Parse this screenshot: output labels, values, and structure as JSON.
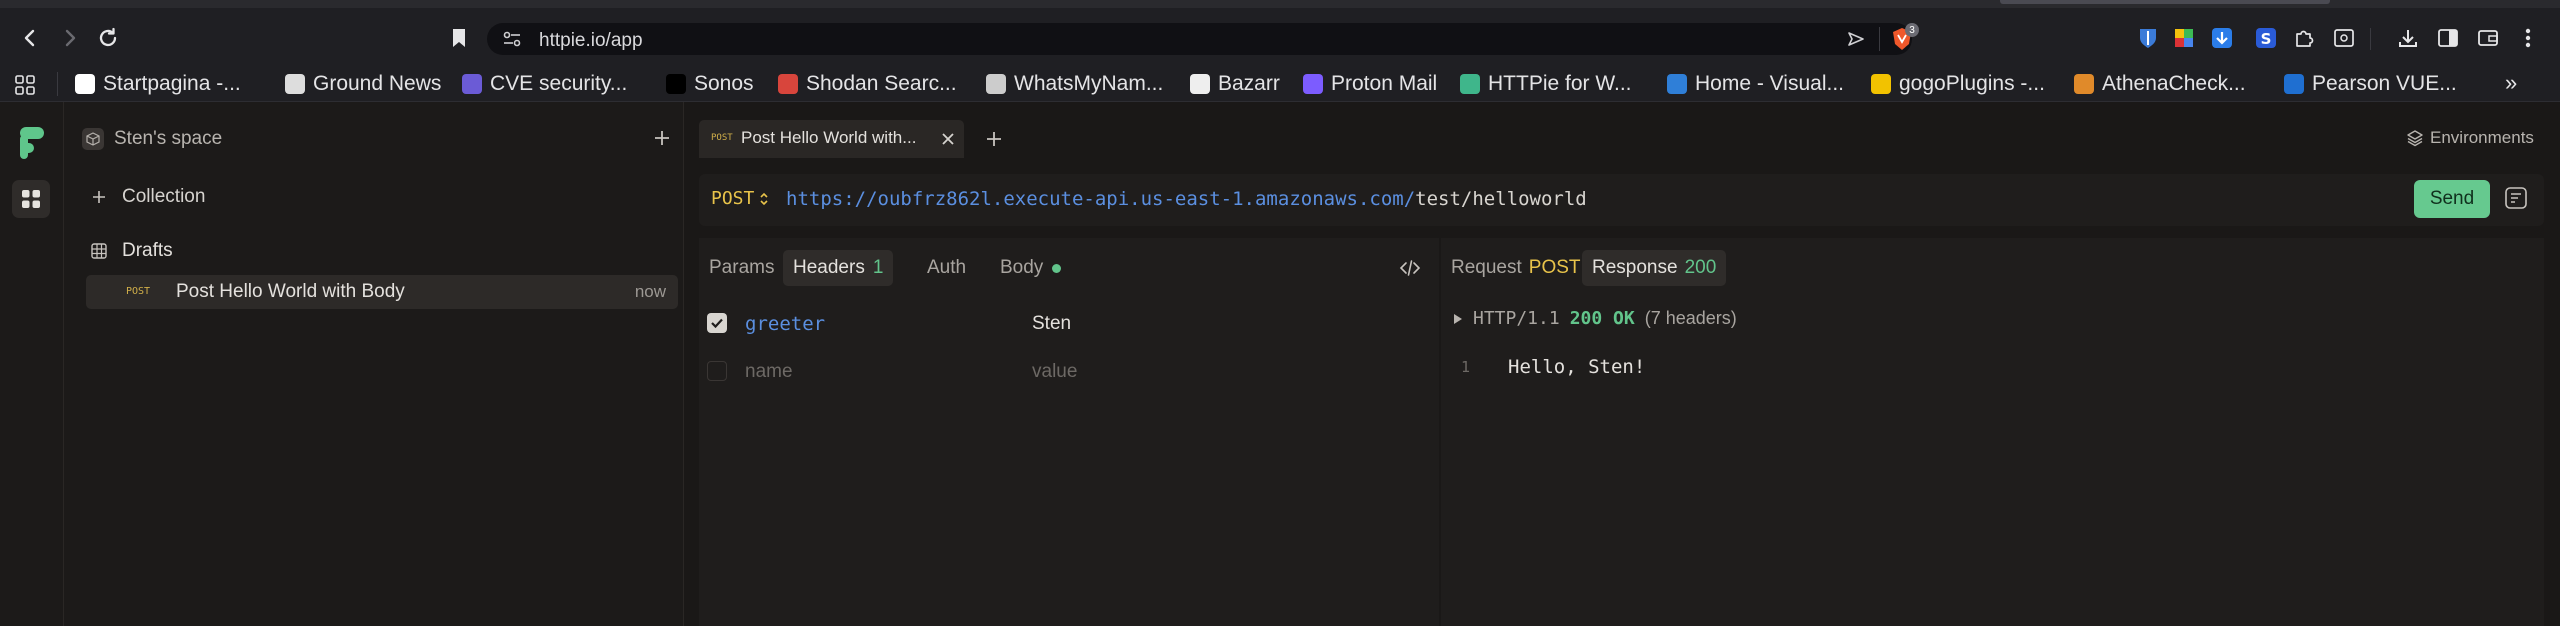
{
  "browser": {
    "url": "httpie.io/app",
    "bookmarks": [
      {
        "label": "Startpagina -...",
        "color": "#ffffff",
        "icon": "dtl-icon"
      },
      {
        "label": "Ground News",
        "color": "#dddddd",
        "icon": "ground-news-icon"
      },
      {
        "label": "CVE security...",
        "color": "#6b5bd6",
        "icon": "cve-icon"
      },
      {
        "label": "Sonos",
        "color": "#000000",
        "icon": "sonos-icon"
      },
      {
        "label": "Shodan Searc...",
        "color": "#d8453c",
        "icon": "shodan-icon"
      },
      {
        "label": "WhatsMyNam...",
        "color": "#cccccc",
        "icon": "whatsmyname-icon"
      },
      {
        "label": "Bazarr",
        "color": "#eeeeee",
        "icon": "bazarr-icon"
      },
      {
        "label": "Proton Mail",
        "color": "#7c5cff",
        "icon": "proton-mail-icon"
      },
      {
        "label": "HTTPie for W...",
        "color": "#3fb68b",
        "icon": "httpie-icon"
      },
      {
        "label": "Home - Visual...",
        "color": "#2f7fd8",
        "icon": "visual-studio-icon"
      },
      {
        "label": "gogoPlugins -...",
        "color": "#f2c200",
        "icon": "gogoplugins-icon"
      },
      {
        "label": "AthenaCheck...",
        "color": "#e08a2a",
        "icon": "athena-icon"
      },
      {
        "label": "Pearson VUE...",
        "color": "#1f6fd1",
        "icon": "pearson-icon"
      }
    ],
    "overflow": "»",
    "brave_badge": "3"
  },
  "sidebar": {
    "space_name": "Sten's space",
    "collection_label": "Collection",
    "drafts_label": "Drafts",
    "draft_item": {
      "method": "POST",
      "name": "Post Hello World with Body",
      "time": "now"
    }
  },
  "tabs": {
    "active": {
      "method": "POST",
      "title": "Post Hello World with..."
    },
    "environments_label": "Environments"
  },
  "request": {
    "method": "POST",
    "url_base": "https://oubfrz862l.execute-api.us-east-1.amazonaws.com/",
    "url_path": "test/helloworld",
    "send_label": "Send",
    "tabs": {
      "params": "Params",
      "headers": "Headers",
      "headers_count": "1",
      "auth": "Auth",
      "body": "Body"
    },
    "headers": [
      {
        "name": "greeter",
        "value": "Sten",
        "enabled": true
      }
    ],
    "placeholder_name": "name",
    "placeholder_value": "value"
  },
  "response": {
    "request_tab": "Request",
    "request_method": "POST",
    "response_tab": "Response",
    "status_code": "200",
    "protocol": "HTTP/1.1",
    "status": "200 OK",
    "headers_count": "(7 headers)",
    "line_number": "1",
    "body": "Hello, Sten!"
  },
  "colors": {
    "accent": "#66c98f",
    "method": "#e8c34a",
    "url": "#5b8fe0",
    "background": "#1a1817"
  }
}
